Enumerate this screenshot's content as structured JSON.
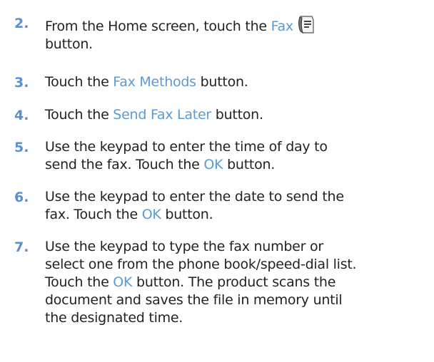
{
  "steps": [
    {
      "number": "2.",
      "pre": "From the Home screen, touch the ",
      "link": "Fax",
      "post_line2": "button.",
      "icon": "fax-icon"
    },
    {
      "number": "3.",
      "pre": "Touch the ",
      "link": "Fax Methods",
      "post": " button."
    },
    {
      "number": "4.",
      "pre": "Touch the ",
      "link": "Send Fax Later",
      "post": " button."
    },
    {
      "number": "5.",
      "line1": "Use the keypad to enter the time of day to",
      "pre": "send the fax. Touch the ",
      "link": "OK",
      "post": " button."
    },
    {
      "number": "6.",
      "line1": "Use the keypad to enter the date to send the",
      "pre": "fax. Touch the ",
      "link": "OK",
      "post": " button."
    },
    {
      "number": "7.",
      "line1": "Use the keypad to type the fax number or",
      "line2": "select one from the phone book/speed-dial list.",
      "pre": "Touch the ",
      "link": "OK",
      "post": " button. The product scans the",
      "line4": "document and saves the file in memory until",
      "line5": "the designated time."
    }
  ],
  "colors": {
    "number": "#5b8fd0",
    "link": "#5b9bd5",
    "text": "#222222"
  }
}
